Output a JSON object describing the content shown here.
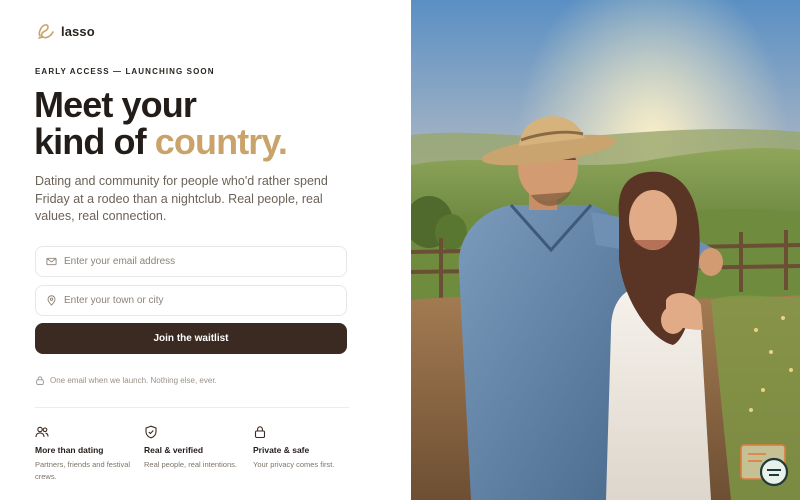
{
  "brand": {
    "name": "lasso"
  },
  "hero": {
    "eyebrow": "EARLY ACCESS — LAUNCHING SOON",
    "headline_line1": "Meet your",
    "headline_line2_prefix": "kind of ",
    "headline_accent": "country.",
    "subtitle": "Dating and community for people who'd rather spend Friday at a rodeo than a nightclub. Real people, real values, real connection."
  },
  "form": {
    "email_placeholder": "Enter your email address",
    "email_value": "",
    "town_placeholder": "Enter your town or city",
    "town_value": "",
    "submit_label": "Join the waitlist",
    "note": "One email when we launch. Nothing else, ever."
  },
  "features": [
    {
      "icon": "users-icon",
      "title": "More than dating",
      "desc": "Partners, friends and festival crews."
    },
    {
      "icon": "shield-check-icon",
      "title": "Real & verified",
      "desc": "Real people, real intentions."
    },
    {
      "icon": "lock-icon",
      "title": "Private & safe",
      "desc": "Your privacy comes first."
    }
  ],
  "colors": {
    "accent": "#c9a36a",
    "button": "#3b2a22",
    "heading": "#231d1a",
    "body_text": "#6b6258",
    "field_border": "#ebe6e1"
  },
  "photo": {
    "subject": "hero-photo-couple"
  }
}
